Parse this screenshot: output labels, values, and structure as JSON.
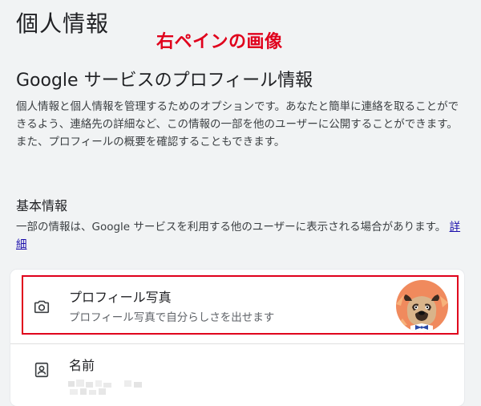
{
  "page": {
    "title": "個人情報",
    "annotation": "右ペインの画像"
  },
  "profile_section": {
    "title": "Google サービスのプロフィール情報",
    "description": "個人情報と個人情報を管理するためのオプションです。あなたと簡単に連絡を取ることができるよう、連絡先の詳細など、この情報の一部を他のユーザーに公開することができます。また、プロフィールの概要を確認することもできます。"
  },
  "basic_info": {
    "title": "基本情報",
    "description": "一部の情報は、Google サービスを利用する他のユーザーに表示される場合があります。",
    "link_label": "詳細"
  },
  "rows": {
    "photo": {
      "label": "プロフィール写真",
      "description": "プロフィール写真で自分らしさを出せます",
      "icon": "camera-icon"
    },
    "name": {
      "label": "名前",
      "icon": "contact-card-icon"
    }
  },
  "colors": {
    "annotation": "#e0001c",
    "link": "#1a0dab",
    "avatar_bg": "#f08a5d"
  }
}
